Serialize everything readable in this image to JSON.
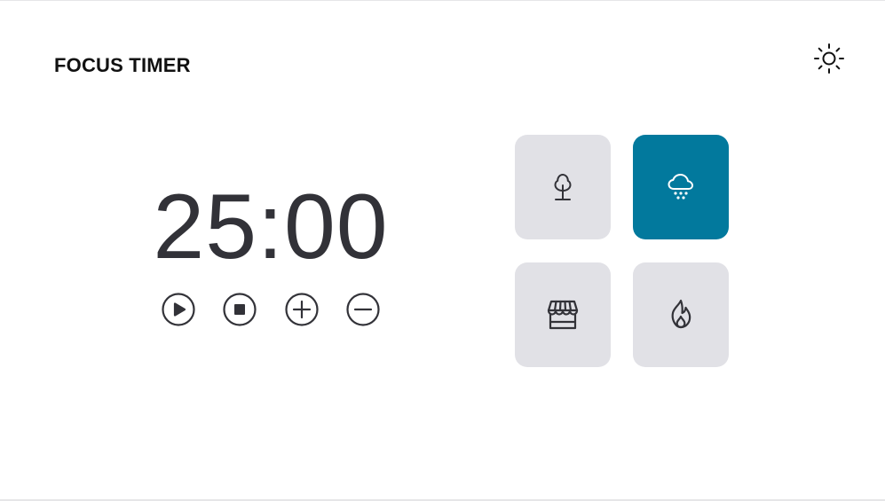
{
  "app": {
    "title": "FOCUS TIMER"
  },
  "header": {
    "theme_icon": "sun-icon"
  },
  "timer": {
    "minutes": "25",
    "separator": ":",
    "seconds": "00",
    "display": "25:00"
  },
  "controls": [
    {
      "name": "play",
      "icon": "play-icon"
    },
    {
      "name": "stop",
      "icon": "stop-icon"
    },
    {
      "name": "increase",
      "icon": "plus-icon"
    },
    {
      "name": "decrease",
      "icon": "minus-icon"
    }
  ],
  "sounds": [
    {
      "name": "forest",
      "icon": "tree-icon",
      "active": false
    },
    {
      "name": "rain",
      "icon": "cloud-rain-icon",
      "active": true
    },
    {
      "name": "coffee-shop",
      "icon": "storefront-icon",
      "active": false
    },
    {
      "name": "fireplace",
      "icon": "flame-icon",
      "active": false
    }
  ],
  "colors": {
    "background": "#ffffff",
    "text": "#323238",
    "card": "#e1e1e6",
    "card_active": "#02799d",
    "active_icon": "#ffffff"
  }
}
